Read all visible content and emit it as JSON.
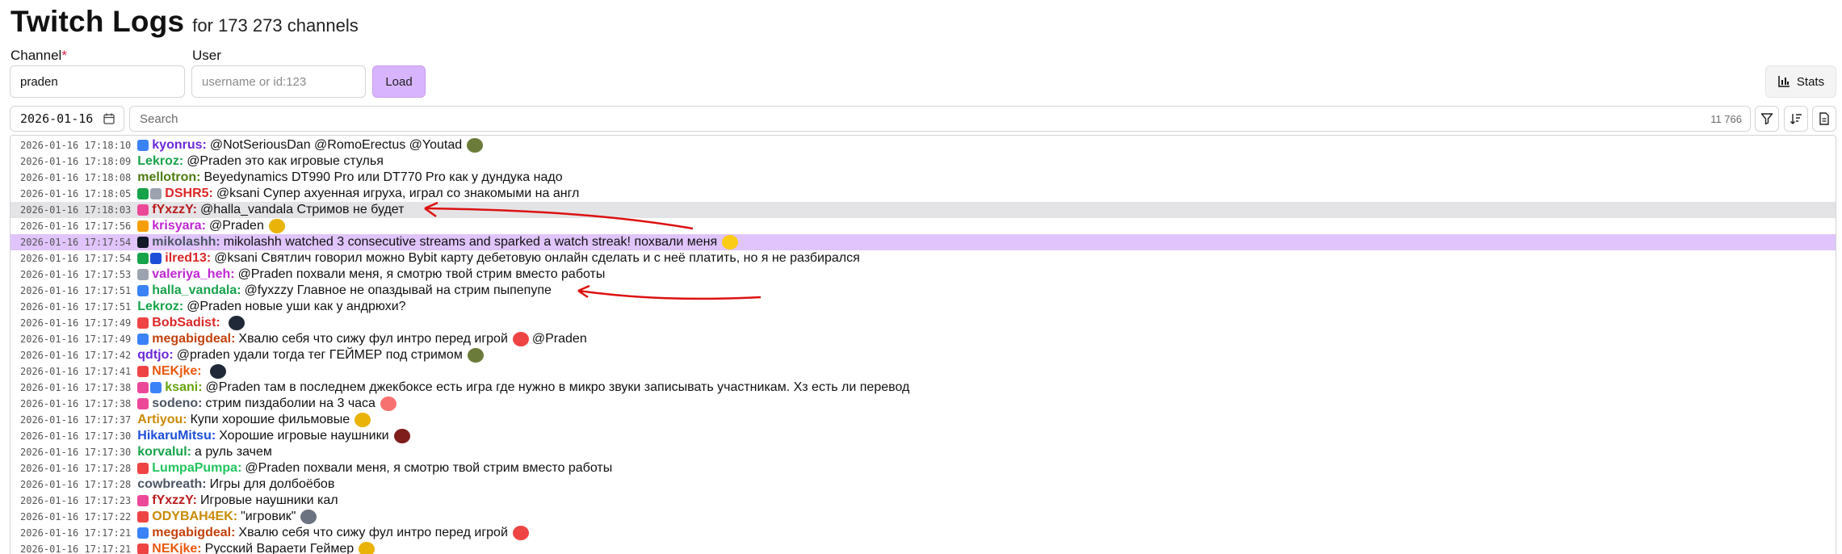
{
  "header": {
    "title": "Twitch Logs",
    "subtitle": "for 173 273 channels"
  },
  "form": {
    "channel_label": "Channel",
    "required_mark": "*",
    "channel_value": "praden",
    "user_label": "User",
    "user_placeholder": "username or id:123",
    "load_label": "Load",
    "stats_label": "Stats"
  },
  "toolbar": {
    "date": "2026-01-16",
    "search_placeholder": "Search",
    "count": "11 766"
  },
  "colors": {
    "accent": "#d8b4fe",
    "highlight_gray": "#e4e4e7",
    "highlight_purple": "#e0c4fb",
    "annotation": "#dd1111"
  },
  "messages": [
    {
      "ts": "2026-01-16 17:18:10",
      "badges": [
        "#3b82f6"
      ],
      "user": "kyonrus:",
      "color": "#6d28d9",
      "text": "@NotSeriousDan @RomoErectus @Youtad",
      "emote": "#6b7c3a"
    },
    {
      "ts": "2026-01-16 17:18:09",
      "badges": [],
      "user": "Lekroz:",
      "color": "#16a34a",
      "text": "@Praden это как игровые стулья"
    },
    {
      "ts": "2026-01-16 17:18:08",
      "badges": [],
      "user": "mellotron:",
      "color": "#4d7c0f",
      "text": "Beyedynamics DT990 Pro или DT770 Pro как у дундука надо"
    },
    {
      "ts": "2026-01-16 17:18:05",
      "badges": [
        "#16a34a",
        "#9ca3af"
      ],
      "user": "DSHR5:",
      "color": "#dc2626",
      "text": "@ksani Супер ахуенная игруха, играл со знакомыми на англ"
    },
    {
      "ts": "2026-01-16 17:18:03",
      "badges": [
        "#ec4899"
      ],
      "user": "fYxzzY:",
      "color": "#b91c1c",
      "text": "@halla_vandala Стримов не будет",
      "hl": "gray"
    },
    {
      "ts": "2026-01-16 17:17:56",
      "badges": [
        "#f59e0b"
      ],
      "user": "krisyara:",
      "color": "#c026d3",
      "text": "@Praden",
      "emote": "#eab308"
    },
    {
      "ts": "2026-01-16 17:17:54",
      "badges": [
        "#111827"
      ],
      "user": "mikolashh:",
      "color": "#4b5563",
      "text": "mikolashh watched 3 consecutive streams and sparked a watch streak! похвали меня",
      "emote": "#facc15",
      "hl": "purple"
    },
    {
      "ts": "2026-01-16 17:17:54",
      "badges": [
        "#16a34a",
        "#1d4ed8"
      ],
      "user": "ilred13:",
      "color": "#dc2626",
      "text": "@ksani Святлич говорил можно Bybit карту дебетовую онлайн сделать и с неё платить, но я не разбирался"
    },
    {
      "ts": "2026-01-16 17:17:53",
      "badges": [
        "#9ca3af"
      ],
      "user": "valeriya_heh:",
      "color": "#c026d3",
      "text": "@Praden похвали меня, я смотрю твой стрим вместо работы"
    },
    {
      "ts": "2026-01-16 17:17:51",
      "badges": [
        "#3b82f6"
      ],
      "user": "halla_vandala:",
      "color": "#16a34a",
      "text": "@fyxzzy Главное не опаздывай на стрим пыпепупе"
    },
    {
      "ts": "2026-01-16 17:17:51",
      "badges": [],
      "user": "Lekroz:",
      "color": "#16a34a",
      "text": "@Praden новые уши как у андрюхи?"
    },
    {
      "ts": "2026-01-16 17:17:49",
      "badges": [
        "#ef4444"
      ],
      "user": "BobSadist:",
      "color": "#dc2626",
      "text": "",
      "emote": "#1f2937"
    },
    {
      "ts": "2026-01-16 17:17:49",
      "badges": [
        "#3b82f6"
      ],
      "user": "megabigdeal:",
      "color": "#c2410c",
      "text": "Хвалю себя что сижу фул интро перед игрой",
      "emote": "#ef4444",
      "tail": "@Praden"
    },
    {
      "ts": "2026-01-16 17:17:42",
      "badges": [],
      "user": "qdtjo:",
      "color": "#6d28d9",
      "text": "@praden удали тогда тег ГЕЙМЕР под стримом",
      "emote": "#6b7c3a"
    },
    {
      "ts": "2026-01-16 17:17:41",
      "badges": [
        "#ef4444"
      ],
      "user": "NEKjke:",
      "color": "#ea580c",
      "text": "",
      "emote": "#1f2937"
    },
    {
      "ts": "2026-01-16 17:17:38",
      "badges": [
        "#ec4899",
        "#3b82f6"
      ],
      "user": "ksani:",
      "color": "#65a30d",
      "text": "@Praden там в последнем джекбоксе есть игра где нужно в микро звуки записывать участникам. Хз есть ли перевод"
    },
    {
      "ts": "2026-01-16 17:17:38",
      "badges": [
        "#ec4899"
      ],
      "user": "sodeno:",
      "color": "#4b5563",
      "text": "стрим пиздаболии на 3 часа",
      "emote": "#f87171"
    },
    {
      "ts": "2026-01-16 17:17:37",
      "badges": [],
      "user": "Artiyou:",
      "color": "#ca8a04",
      "text": "Купи хорошие фильмовые",
      "emote": "#eab308"
    },
    {
      "ts": "2026-01-16 17:17:30",
      "badges": [],
      "user": "HikaruMitsu:",
      "color": "#1d4ed8",
      "text": "Хорошие игровые наушники",
      "emote": "#7f1d1d"
    },
    {
      "ts": "2026-01-16 17:17:30",
      "badges": [],
      "user": "korvalul:",
      "color": "#16a34a",
      "text": "а руль зачем"
    },
    {
      "ts": "2026-01-16 17:17:28",
      "badges": [
        "#ef4444"
      ],
      "user": "LumpaPumpa:",
      "color": "#22c55e",
      "text": "@Praden похвали меня, я смотрю твой стрим вместо работы"
    },
    {
      "ts": "2026-01-16 17:17:28",
      "badges": [],
      "user": "cowbreath:",
      "color": "#4b5563",
      "text": "Игры для долбоёбов"
    },
    {
      "ts": "2026-01-16 17:17:23",
      "badges": [
        "#ec4899"
      ],
      "user": "fYxzzY:",
      "color": "#b91c1c",
      "text": "Игровые наушники кал"
    },
    {
      "ts": "2026-01-16 17:17:22",
      "badges": [
        "#ef4444"
      ],
      "user": "ODYBAH4EK:",
      "color": "#ca8a04",
      "text": "\"игровик\"",
      "emote": "#6b7280"
    },
    {
      "ts": "2026-01-16 17:17:21",
      "badges": [
        "#3b82f6"
      ],
      "user": "megabigdeal:",
      "color": "#c2410c",
      "text": "Хвалю себя что сижу фул интро перед игрой",
      "emote": "#ef4444"
    },
    {
      "ts": "2026-01-16 17:17:21",
      "badges": [
        "#ef4444"
      ],
      "user": "NEKjke:",
      "color": "#ea580c",
      "text": "Русский Вараети Геймер",
      "emote": "#eab308"
    }
  ]
}
